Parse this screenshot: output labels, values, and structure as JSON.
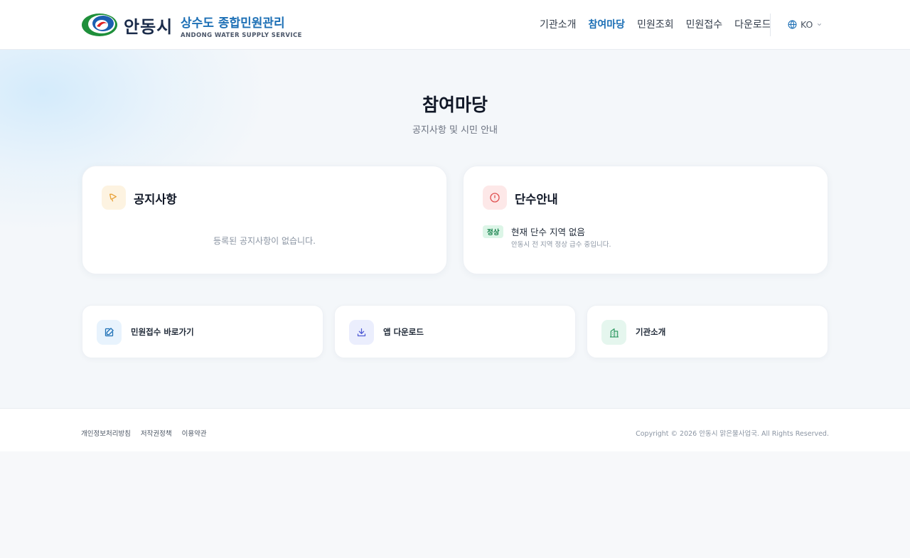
{
  "header": {
    "logo_city": "안동시",
    "logo_title": "상수도 종합민원관리",
    "logo_subtitle": "ANDONG WATER SUPPLY SERVICE",
    "nav": [
      {
        "label": "기관소개",
        "active": false
      },
      {
        "label": "참여마당",
        "active": true
      },
      {
        "label": "민원조회",
        "active": false
      },
      {
        "label": "민원접수",
        "active": false
      },
      {
        "label": "다운로드",
        "active": false
      }
    ],
    "language": "KO"
  },
  "hero": {
    "title": "참여마당",
    "subtitle": "공지사항 및 시민 안내"
  },
  "notice_card": {
    "title": "공지사항",
    "empty_text": "등록된 공지사항이 없습니다."
  },
  "water_card": {
    "title": "단수안내",
    "badge": "정상",
    "status_title": "현재 단수 지역 없음",
    "status_desc": "안동시 전 지역 정상 급수 중입니다."
  },
  "quick_links": [
    {
      "label": "민원접수 바로가기",
      "icon": "edit-icon"
    },
    {
      "label": "앱 다운로드",
      "icon": "download-icon"
    },
    {
      "label": "기관소개",
      "icon": "building-icon"
    }
  ],
  "footer": {
    "links": [
      "개인정보처리방침",
      "저작권정책",
      "이용약관"
    ],
    "copyright": "Copyright © 2026 안동시 맑은물사업국. All Rights Reserved."
  },
  "colors": {
    "primary": "#1c6fb5",
    "badge_bg": "#dcf5e7",
    "badge_text": "#14804a",
    "notice_icon_bg": "#fdf3e1",
    "water_icon_bg": "#fde8e8"
  }
}
